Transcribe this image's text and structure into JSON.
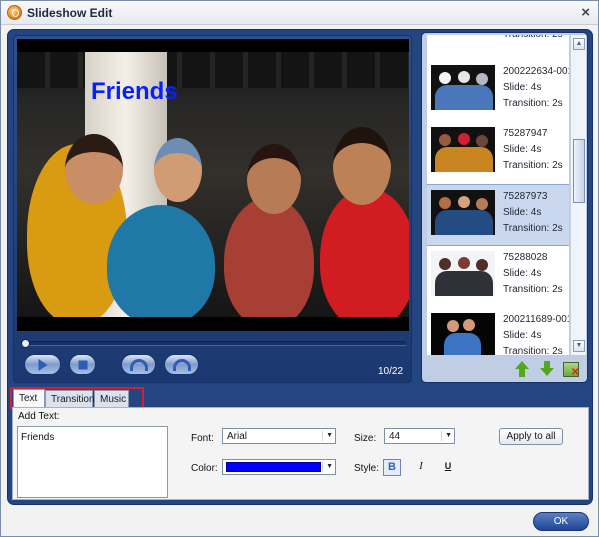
{
  "window": {
    "title": "Slideshow Edit",
    "close_symbol": "×"
  },
  "preview": {
    "overlay_text": "Friends",
    "counter": "10/22",
    "progress": 0
  },
  "slides": [
    {
      "name": "",
      "slide": "",
      "transition": "Transition: 2s",
      "selected": false
    },
    {
      "name": "200222634-001",
      "slide": "Slide: 4s",
      "transition": "Transition: 2s",
      "selected": false
    },
    {
      "name": "75287947",
      "slide": "Slide: 4s",
      "transition": "Transition: 2s",
      "selected": false
    },
    {
      "name": "75287973",
      "slide": "Slide: 4s",
      "transition": "Transition: 2s",
      "selected": true
    },
    {
      "name": "75288028",
      "slide": "Slide: 4s",
      "transition": "Transition: 2s",
      "selected": false
    },
    {
      "name": "200211689-001",
      "slide": "Slide: 4s",
      "transition": "Transition: 2s",
      "selected": false
    }
  ],
  "tabs": [
    {
      "label": "Text",
      "active": true
    },
    {
      "label": "Transition",
      "active": false
    },
    {
      "label": "Music",
      "active": false
    }
  ],
  "text_editor": {
    "add_label": "Add Text:",
    "text_value": "Friends",
    "font_label": "Font:",
    "font_value": "Arial",
    "size_label": "Size:",
    "size_value": "44",
    "color_label": "Color:",
    "color_value": "#0000ff",
    "style_label": "Style:",
    "bold_label": "B",
    "italic_label": "I",
    "underline_label": "U",
    "apply_label": "Apply to all"
  },
  "footer": {
    "ok_label": "OK"
  },
  "icons": {
    "play": "play-icon",
    "stop": "stop-icon",
    "rotate_left": "rotate-left-icon",
    "rotate_right": "rotate-right-icon",
    "move_up": "move-up-icon",
    "move_down": "move-down-icon",
    "remove": "remove-slide-icon",
    "dropdown": "chevron-down-icon"
  },
  "colors": {
    "accent": "#24457f",
    "selected_row": "#c9d8ef",
    "tab_highlight": "#d51d36",
    "text_color": "#0000ff"
  }
}
